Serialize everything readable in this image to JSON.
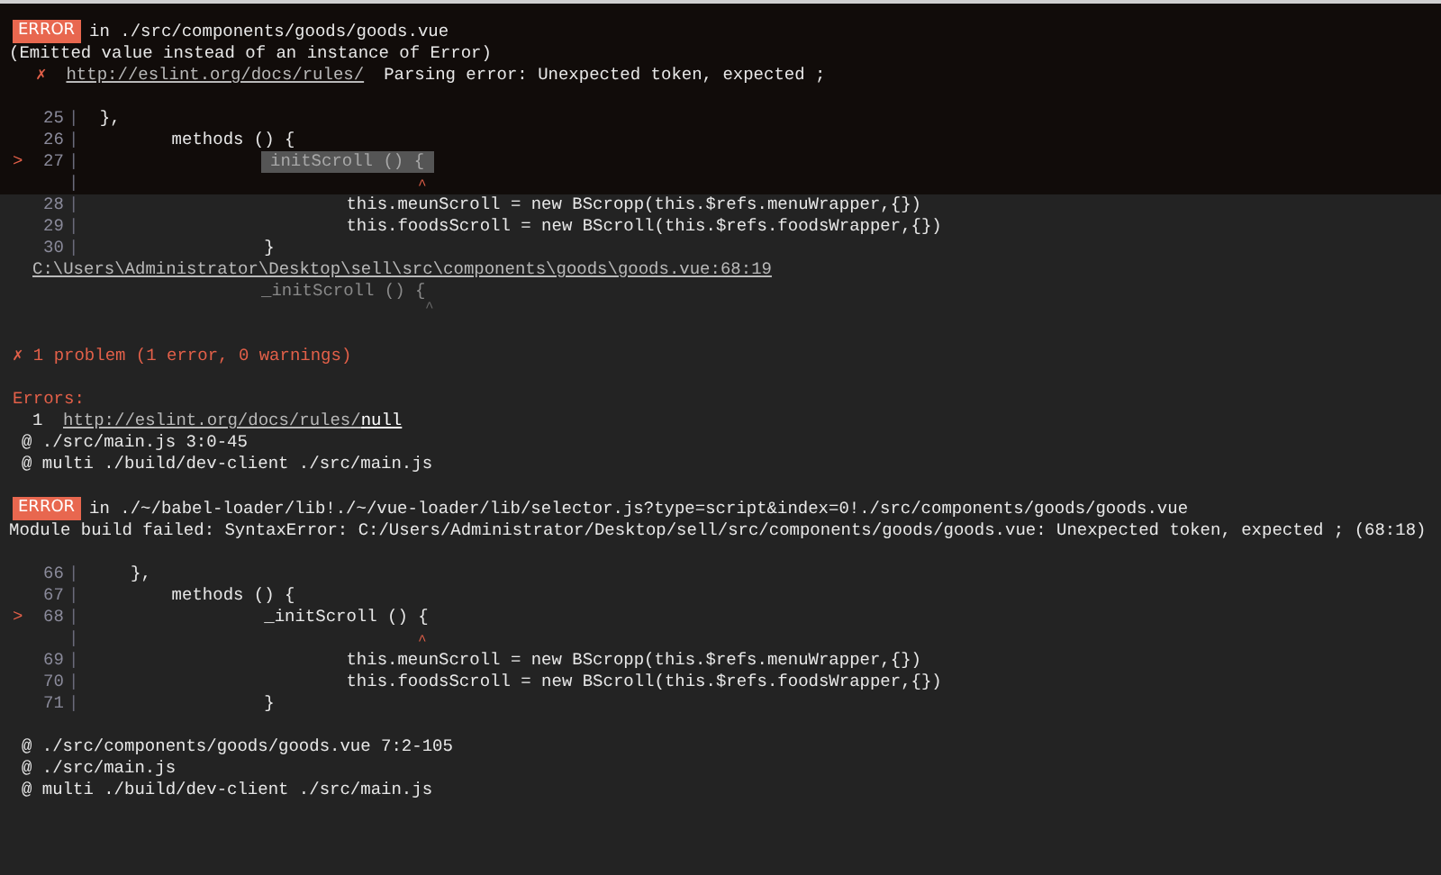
{
  "sections": [
    {
      "lines": [
        {
          "kind": "error",
          "badge": "ERROR",
          "text": "in ./src/components/goods/goods.vue"
        },
        {
          "kind": "text",
          "text": "(Emitted value instead of an instance of Error)"
        },
        {
          "kind": "rule",
          "mark": "✗",
          "link": "http://eslint.org/docs/rules/",
          "text": "Parsing error: Unexpected token, expected ;"
        },
        {
          "kind": "blank"
        },
        {
          "kind": "code",
          "number": "25",
          "gutter": "|",
          "code": "  },",
          "highlighted": false
        },
        {
          "kind": "code",
          "number": "26",
          "gutter": "|",
          "code": "         methods () {",
          "highlighted": false
        },
        {
          "kind": "code",
          "marker": ">",
          "number": "27",
          "gutter": "|",
          "code": "initScroll () {",
          "highlighted": true
        },
        {
          "kind": "caret",
          "gutter": "|",
          "text": "^"
        }
      ]
    },
    {
      "lines": [
        {
          "kind": "code",
          "number": "28",
          "gutter": "|",
          "code": "                          this.meunScroll = new BScropp(this.$refs.menuWrapper,{})",
          "highlighted": false
        },
        {
          "kind": "code",
          "number": "29",
          "gutter": "|",
          "code": "                          this.foodsScroll = new BScroll(this.$refs.foodsWrapper,{})",
          "highlighted": false
        },
        {
          "kind": "code",
          "number": "30",
          "gutter": "|",
          "code": "                  }",
          "highlighted": false
        },
        {
          "kind": "path",
          "text": "C:\\Users\\Administrator\\Desktop\\sell\\src\\components\\goods\\goods.vue:68:19"
        },
        {
          "kind": "excerpt",
          "text": "_initScroll () {"
        },
        {
          "kind": "excerpt_caret",
          "text": "^"
        },
        {
          "kind": "blank"
        },
        {
          "kind": "problem",
          "text": "✗ 1 problem (1 error, 0 warnings)"
        },
        {
          "kind": "blank"
        },
        {
          "kind": "errors_heading",
          "text": "Errors:"
        },
        {
          "kind": "rule_ref",
          "count": "1",
          "link": "http://eslint.org/docs/rules/",
          "rule": "null"
        },
        {
          "kind": "trace",
          "text": "@ ./src/main.js 3:0-45"
        },
        {
          "kind": "trace",
          "text": "@ multi ./build/dev-client ./src/main.js"
        },
        {
          "kind": "blank"
        },
        {
          "kind": "error",
          "badge": "ERROR",
          "text": "in ./~/babel-loader/lib!./~/vue-loader/lib/selector.js?type=script&index=0!./src/components/goods/goods.vue"
        },
        {
          "kind": "text",
          "text": "Module build failed: SyntaxError: C:/Users/Administrator/Desktop/sell/src/components/goods/goods.vue: Unexpected token, expected ; (68:18)"
        },
        {
          "kind": "blank"
        },
        {
          "kind": "code",
          "number": "66",
          "gutter": "|",
          "code": "     },",
          "highlighted": false
        },
        {
          "kind": "code",
          "number": "67",
          "gutter": "|",
          "code": "         methods () {",
          "highlighted": false
        },
        {
          "kind": "code",
          "marker": ">",
          "number": "68",
          "gutter": "|",
          "code": "                  _initScroll () {",
          "highlighted": false
        },
        {
          "kind": "caret",
          "gutter": "|",
          "text": "^"
        },
        {
          "kind": "code",
          "number": "69",
          "gutter": "|",
          "code": "                          this.meunScroll = new BScropp(this.$refs.menuWrapper,{})",
          "highlighted": false
        },
        {
          "kind": "code",
          "number": "70",
          "gutter": "|",
          "code": "                          this.foodsScroll = new BScroll(this.$refs.foodsWrapper,{})",
          "highlighted": false
        },
        {
          "kind": "code",
          "number": "71",
          "gutter": "|",
          "code": "                  }",
          "highlighted": false
        },
        {
          "kind": "blank"
        },
        {
          "kind": "trace",
          "text": "@ ./src/components/goods/goods.vue 7:2-105"
        },
        {
          "kind": "trace",
          "text": "@ ./src/main.js"
        },
        {
          "kind": "trace",
          "text": "@ multi ./build/dev-client ./src/main.js"
        }
      ]
    }
  ]
}
